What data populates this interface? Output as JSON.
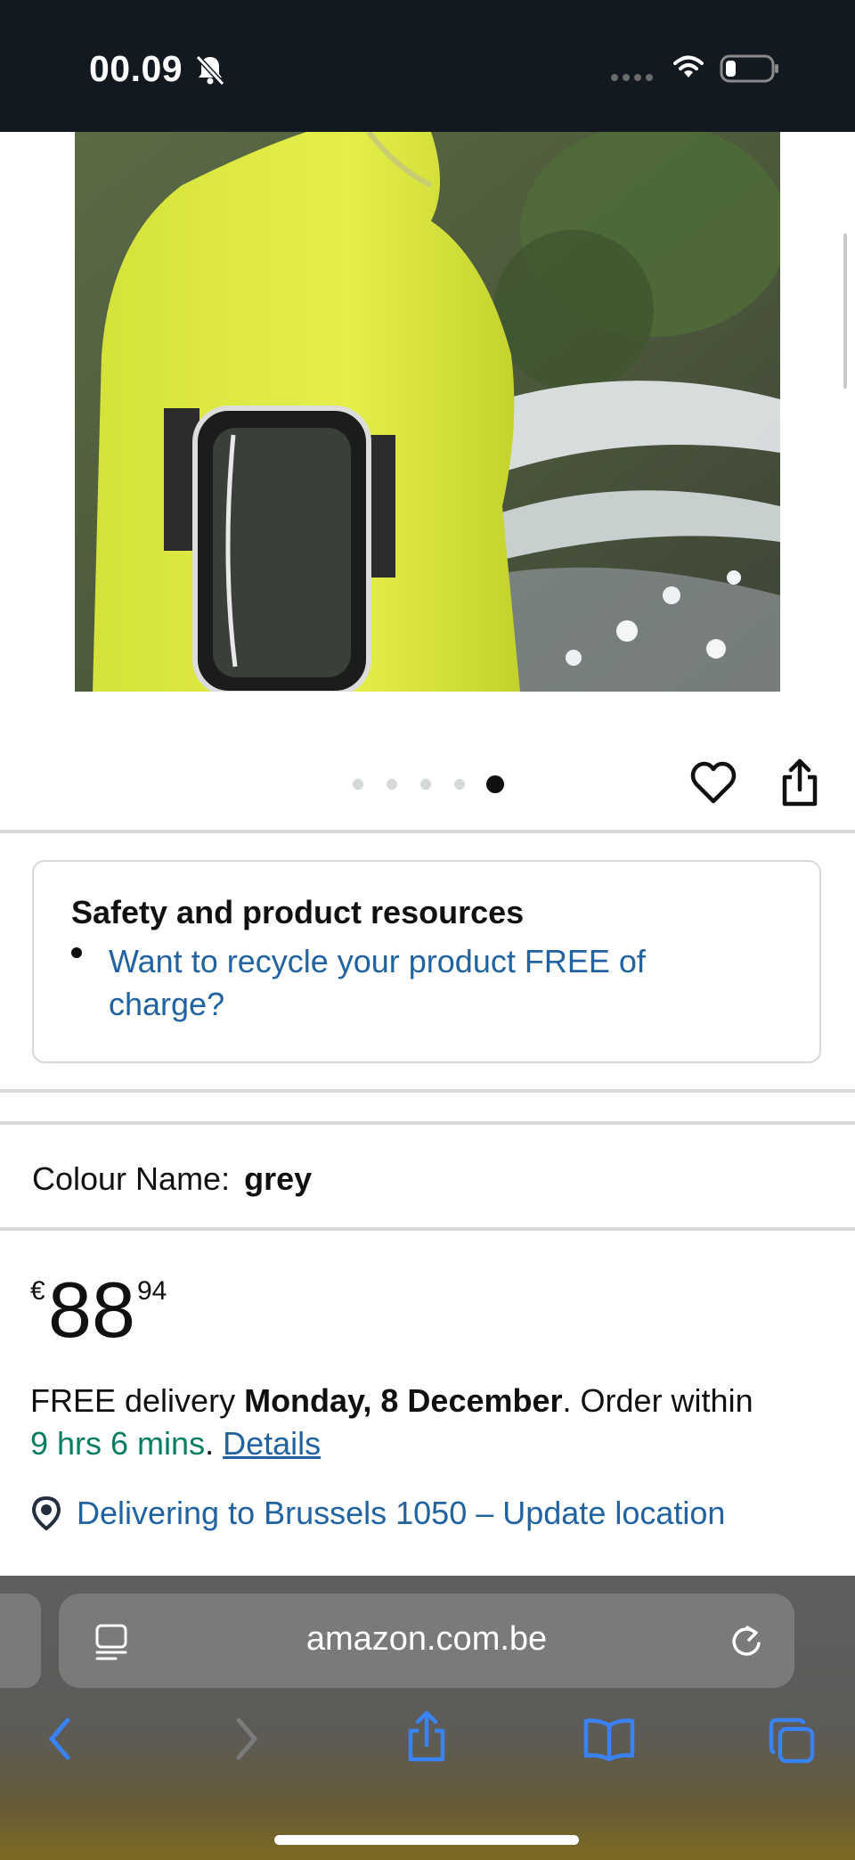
{
  "status_bar": {
    "time": "00.09",
    "icons": [
      "bell-slash-icon",
      "cellular-signal-icon",
      "wifi-icon",
      "battery-icon"
    ]
  },
  "product": {
    "image_description_icon": "product-photo-armband",
    "carousel": {
      "total": 5,
      "active_index": 4
    },
    "actions": [
      "heart-icon",
      "share-icon"
    ]
  },
  "safety": {
    "title": "Safety and product resources",
    "link_text": "Want to recycle your product FREE of charge?"
  },
  "colour": {
    "label": "Colour Name:",
    "value": "grey"
  },
  "price": {
    "currency": "€",
    "whole": "88",
    "fraction": "94"
  },
  "delivery": {
    "prefix": "FREE delivery ",
    "date": "Monday, 8 December",
    "middle": ". Order within",
    "countdown": "9 hrs 6 mins",
    "sep": ". ",
    "details_link": "Details"
  },
  "location": {
    "text": "Delivering to Brussels 1050 – Update location"
  },
  "browser": {
    "url": "amazon.com.be",
    "toolbar": [
      "back-icon",
      "forward-icon",
      "share-icon",
      "bookmarks-icon",
      "tabs-icon"
    ]
  },
  "colors": {
    "header_bg": "#131921",
    "link": "#2162a1",
    "green": "#067d62",
    "ios_blue": "#3a82f7"
  }
}
